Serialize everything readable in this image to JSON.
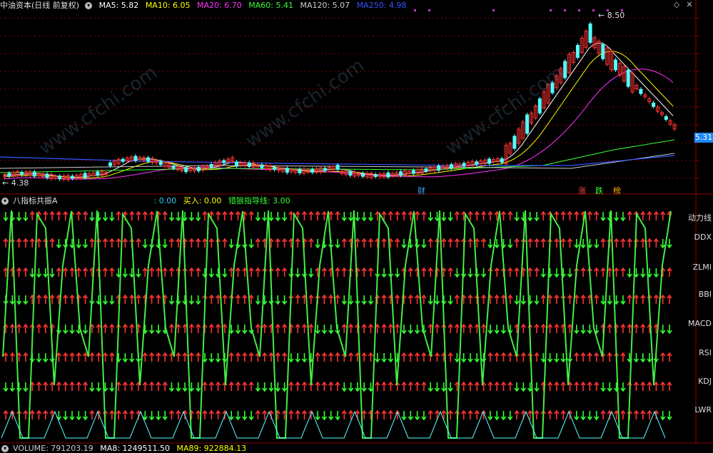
{
  "main": {
    "title": "中油资本(日线 前复权)",
    "ma": [
      {
        "label": "MA5: 5.82",
        "color": "#ffffff"
      },
      {
        "label": "MA10: 6.05",
        "color": "#ffff00"
      },
      {
        "label": "MA20: 6.70",
        "color": "#ff33ff"
      },
      {
        "label": "MA60: 5.41",
        "color": "#33ff33"
      },
      {
        "label": "MA120: 5.07",
        "color": "#cccccc"
      },
      {
        "label": "MA250: 4.98",
        "color": "#3355ff"
      }
    ],
    "high_label": "8.50",
    "low_label": "4.38",
    "price_tag": "5.31",
    "markers": {
      "cai": "财",
      "zhang": "涨",
      "die": "跌",
      "bang": "榜"
    }
  },
  "indicator": {
    "title": "八指标共振A",
    "values": [
      {
        "label": ": 0.00",
        "color": "#33ccff"
      },
      {
        "label": "买入: 0.00",
        "color": "#ffff00"
      },
      {
        "label": "猎狼指导线: 3.00",
        "color": "#33ff33"
      }
    ],
    "rows": [
      "动力线",
      "DDX",
      "ZLMI",
      "BBI",
      "MACD",
      "RSI",
      "KDJ",
      "LWR"
    ]
  },
  "volume": {
    "items": [
      {
        "label": "VOLUME: 791203.19",
        "color": "#cccccc"
      },
      {
        "label": "MA8: 1249511.50",
        "color": "#ffffff"
      },
      {
        "label": "MA89: 922884.13",
        "color": "#ffff00"
      }
    ]
  },
  "watermark": "www.cfchi.com",
  "colors": {
    "up": "#ff3333",
    "down": "#33ff33",
    "cyan": "#54ffff",
    "grid": "#8a0000"
  }
}
